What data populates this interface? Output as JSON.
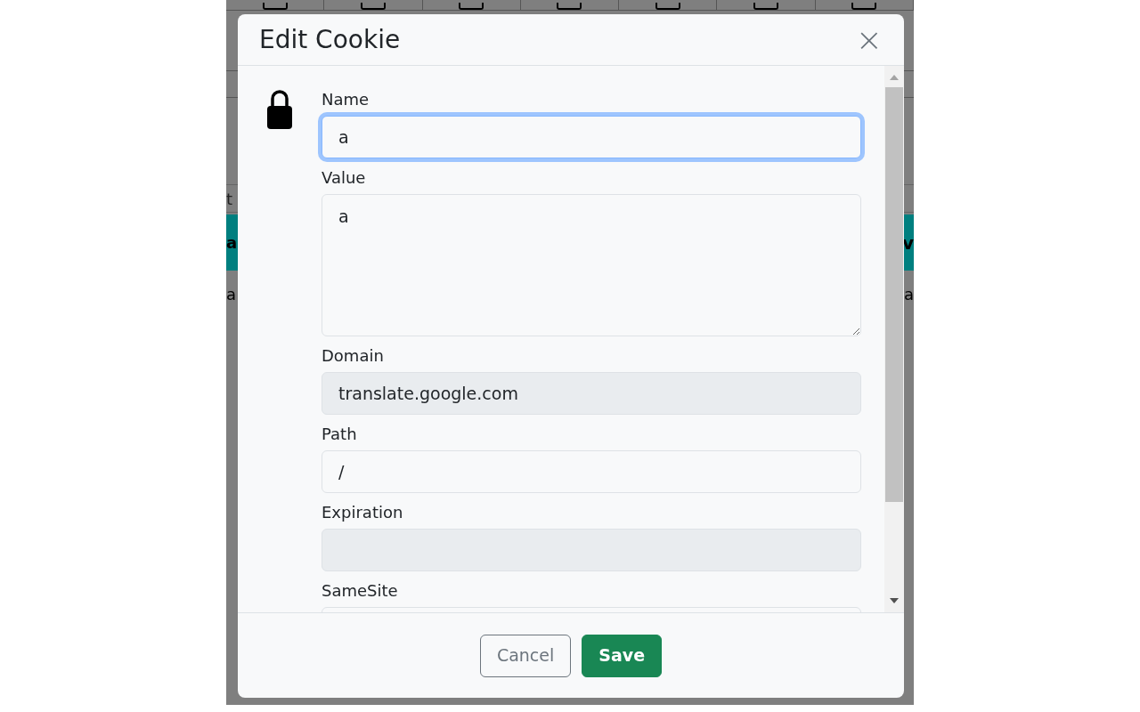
{
  "background": {
    "url_field": {
      "left": "t"
    },
    "table_header": {
      "left": "a",
      "right": "v"
    },
    "table_row": {
      "left": "a",
      "right": "a"
    }
  },
  "dialog": {
    "title": "Edit Cookie",
    "close": "×",
    "fields": [
      {
        "label": "Name",
        "kind": "input",
        "value": "a",
        "focused": true,
        "disabled": false
      },
      {
        "label": "Value",
        "kind": "textarea",
        "value": "a",
        "focused": false,
        "disabled": false
      },
      {
        "label": "Domain",
        "kind": "input",
        "value": "translate.google.com",
        "focused": false,
        "disabled": true
      },
      {
        "label": "Path",
        "kind": "input",
        "value": "/",
        "focused": false,
        "disabled": false
      },
      {
        "label": "Expiration",
        "kind": "input",
        "focused": false,
        "disabled": true
      },
      {
        "label": "SameSite",
        "kind": "input",
        "focused": false,
        "disabled": false
      }
    ],
    "buttons": [
      {
        "label": "Cancel",
        "kind": "secondary"
      },
      {
        "label": "Save",
        "kind": "primary"
      }
    ]
  }
}
